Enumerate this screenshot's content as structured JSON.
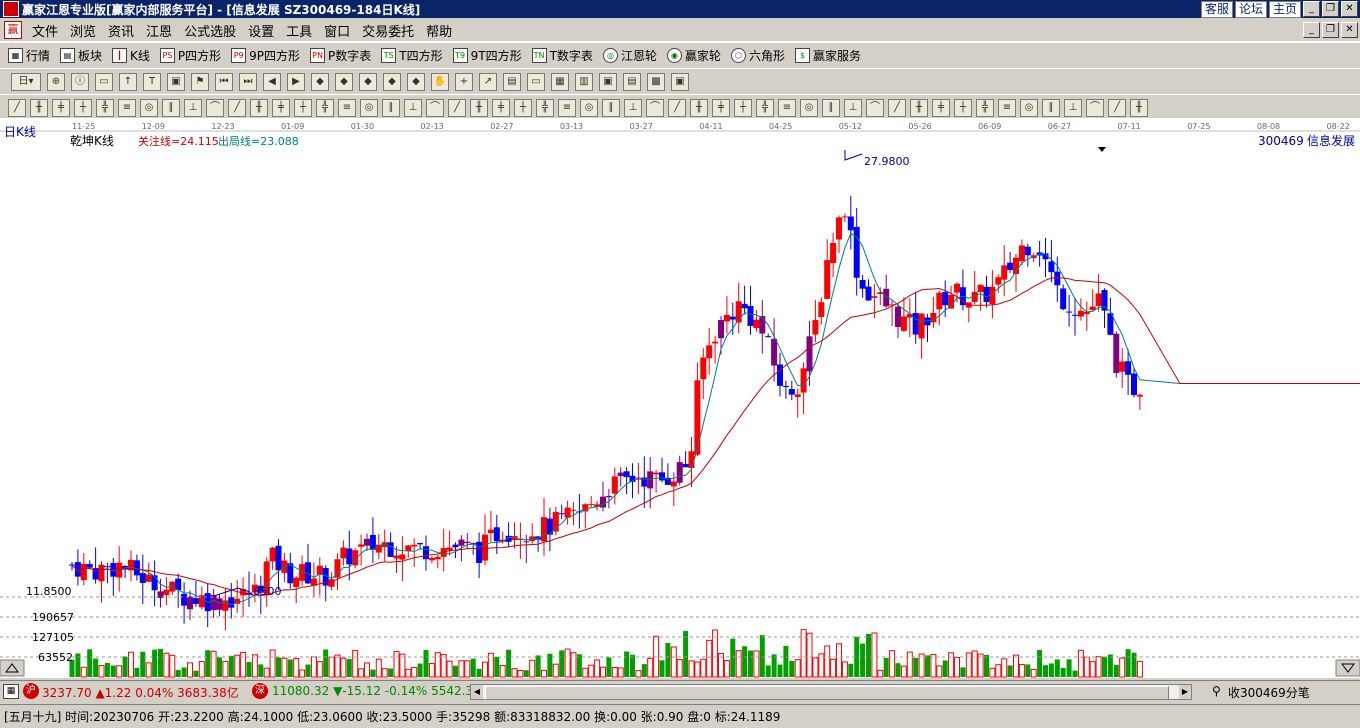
{
  "window": {
    "title": "赢家江恩专业版[赢家内部服务平台] - [信息发展  SZ300469-184日K线]",
    "links": [
      "客服",
      "论坛",
      "主页"
    ]
  },
  "menu": [
    "文件",
    "浏览",
    "资讯",
    "江恩",
    "公式选股",
    "设置",
    "工具",
    "窗口",
    "交易委托",
    "帮助"
  ],
  "toolbar1": [
    {
      "icon": "table-icon",
      "label": "行情"
    },
    {
      "icon": "blocks-icon",
      "label": "板块"
    },
    {
      "icon": "candlestick-icon",
      "label": "K线"
    },
    {
      "icon": "ps-icon",
      "label": "P四方形"
    },
    {
      "icon": "p9-icon",
      "label": "9P四方形"
    },
    {
      "icon": "pn-icon",
      "label": "P数字表"
    },
    {
      "icon": "ts-icon",
      "label": "T四方形"
    },
    {
      "icon": "t9-icon",
      "label": "9T四方形"
    },
    {
      "icon": "tn-icon",
      "label": "T数字表"
    },
    {
      "icon": "gann-wheel-icon",
      "label": "江恩轮"
    },
    {
      "icon": "winner-wheel-icon",
      "label": "赢家轮"
    },
    {
      "icon": "hexagon-icon",
      "label": "六角形"
    },
    {
      "icon": "service-icon",
      "label": "赢家服务"
    }
  ],
  "toolbar2_period": "日",
  "chart": {
    "period_label": "日K线",
    "indicator_name": "乾坤K线",
    "line1_text": "关注线=24.115",
    "line2_text": "出局线=23.088",
    "stock_code": "300469",
    "stock_name": "信息发展",
    "price_axis_label": "11.8500",
    "high_label": "27.9800",
    "low_label": ".8500",
    "volume_axis": [
      "190657",
      "127105",
      "63552"
    ],
    "date_axis": [
      "11-25",
      "12-09",
      "12-23",
      "01-09",
      "01-30",
      "02-13",
      "02-27",
      "03-13",
      "03-27",
      "04-11",
      "04-25",
      "05-12",
      "05-26",
      "06-09",
      "06-27",
      "07-11",
      "07-25",
      "08-08",
      "08-22"
    ],
    "colors": {
      "up": "#ff0000",
      "down": "#0000ff",
      "mid": "#800080",
      "ma_short": "#008080",
      "ma_long": "#cc0000",
      "vol_up": "#ff0000",
      "vol_down": "#00a000"
    }
  },
  "index_bar": {
    "sh_badge": "沪",
    "sh_text": "3237.70 ▲1.22 0.04% 3683.38亿",
    "sz_badge": "深",
    "sz_text": "11080.32 ▼-15.12 -0.14% 5542.3",
    "right_text": "收300469分笔"
  },
  "status_bar": "[五月十九] 时间:20230706 开:23.2200 高:24.1000 低:23.0600 收:23.5000 手:35298 额:83318832.00 换:0.00 张:0.90 盘:0 标:24.1189"
}
